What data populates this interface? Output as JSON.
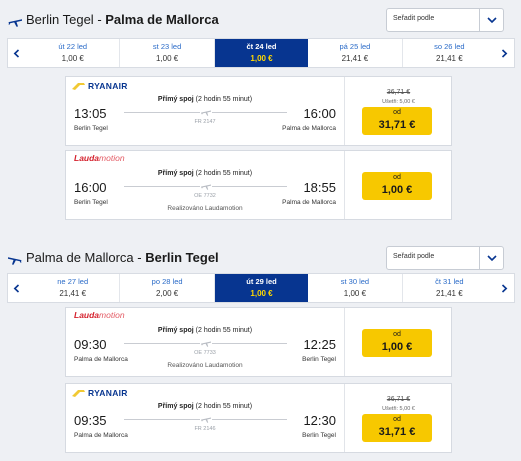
{
  "outbound": {
    "from": "Berlin Tegel",
    "separator": " - ",
    "to": "Palma de Mallorca",
    "sort_label": "Seřadit podle",
    "dates": [
      {
        "label": "út 22 led",
        "price": "1,00 €"
      },
      {
        "label": "st 23 led",
        "price": "1,00 €"
      },
      {
        "label": "čt 24 led",
        "price": "1,00 €",
        "selected": true
      },
      {
        "label": "pá 25 led",
        "price": "21,41 €"
      },
      {
        "label": "so 26 led",
        "price": "21,41 €"
      }
    ],
    "flights": [
      {
        "airline": "RYANAIR",
        "dep_time": "13:05",
        "dep_place": "Berlin Tegel",
        "arr_time": "16:00",
        "arr_place": "Palma de Mallorca",
        "direct": "Přímý spoj",
        "duration": "(2 hodin 55 minut)",
        "flight_no": "FR 2147",
        "old_price": "36,71 €",
        "saving": "Ušetři: 5,00 €",
        "od": "od",
        "price": "31,71 €"
      },
      {
        "airline_a": "Lauda",
        "airline_b": "motion",
        "dep_time": "16:00",
        "dep_place": "Berlin Tegel",
        "arr_time": "18:55",
        "arr_place": "Palma de Mallorca",
        "direct": "Přímý spoj",
        "duration": "(2 hodin 55 minut)",
        "flight_no": "OE 7732",
        "operated": "Realizováno Laudamotion",
        "od": "od",
        "price": "1,00 €"
      }
    ]
  },
  "return": {
    "from": "Palma de Mallorca",
    "separator": " - ",
    "to": "Berlin Tegel",
    "sort_label": "Seřadit podle",
    "dates": [
      {
        "label": "ne 27 led",
        "price": "21,41 €"
      },
      {
        "label": "po 28 led",
        "price": "2,00 €"
      },
      {
        "label": "út 29 led",
        "price": "1,00 €",
        "selected": true
      },
      {
        "label": "st 30 led",
        "price": "1,00 €"
      },
      {
        "label": "čt 31 led",
        "price": "21,41 €"
      }
    ],
    "flights": [
      {
        "airline_a": "Lauda",
        "airline_b": "motion",
        "dep_time": "09:30",
        "dep_place": "Palma de Mallorca",
        "arr_time": "12:25",
        "arr_place": "Berlin Tegel",
        "direct": "Přímý spoj",
        "duration": "(2 hodin 55 minut)",
        "flight_no": "OE 7733",
        "operated": "Realizováno Laudamotion",
        "od": "od",
        "price": "1,00 €"
      },
      {
        "airline": "RYANAIR",
        "dep_time": "09:35",
        "dep_place": "Palma de Mallorca",
        "arr_time": "12:30",
        "arr_place": "Berlin Tegel",
        "direct": "Přímý spoj",
        "duration": "(2 hodin 55 minut)",
        "flight_no": "FR 2146",
        "old_price": "36,71 €",
        "saving": "Ušetři: 5,00 €",
        "od": "od",
        "price": "31,71 €"
      }
    ]
  },
  "colors": {
    "brand_blue": "#073590",
    "price_yellow": "#f7c800",
    "selected_price": "#ffd800",
    "lauda_red": "#d5232f",
    "link_blue": "#2a6bc8"
  },
  "icons": [
    "plane-icon",
    "chevron-down-icon",
    "chevron-left-icon",
    "chevron-right-icon",
    "harp-icon",
    "mini-plane-icon"
  ]
}
